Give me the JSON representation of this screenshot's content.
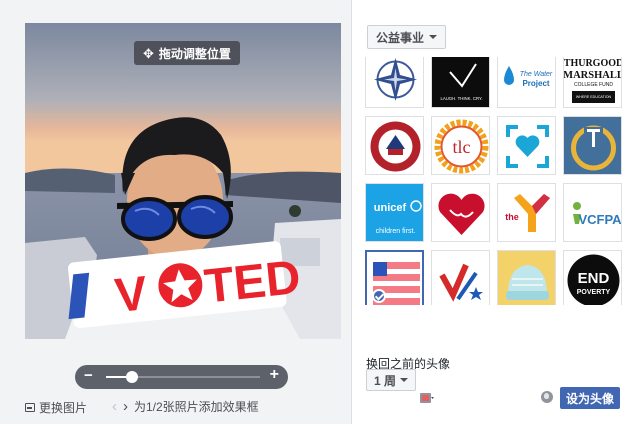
{
  "preview": {
    "drag_hint": "拖动调整位置",
    "sticker_text": "I VOTED",
    "zoom_level": 0.17
  },
  "left_footer": {
    "change_photo": "更换图片",
    "frame_nav_label": "为1/2张照片添加效果框"
  },
  "right": {
    "category": "公益事业",
    "frames": [
      {
        "name": "compass-star-frame",
        "text": ""
      },
      {
        "name": "laugh-think-cry-frame",
        "text": "LAUGH. THINK. CRY."
      },
      {
        "name": "water-project-frame",
        "text": "The Water Project"
      },
      {
        "name": "thurgood-marshall-frame",
        "text": "THURGOOD MARSHALL COLLEGE FUND"
      },
      {
        "name": "seal-frame",
        "text": ""
      },
      {
        "name": "tlc-frame",
        "text": "tlc"
      },
      {
        "name": "heart-focus-frame",
        "text": ""
      },
      {
        "name": "power-t-frame",
        "text": ""
      },
      {
        "name": "unicef-frame",
        "text": "unicef USA children first."
      },
      {
        "name": "red-heart-frame",
        "text": ""
      },
      {
        "name": "ymca-frame",
        "text": "the Y"
      },
      {
        "name": "vcfpa-frame",
        "text": "VCFPA"
      },
      {
        "name": "flag-frame",
        "text": ""
      },
      {
        "name": "check-frame",
        "text": ""
      },
      {
        "name": "knit-hat-frame",
        "text": ""
      },
      {
        "name": "end-poverty-frame",
        "text": "END POVERTY"
      }
    ],
    "selected_index": 12,
    "revert_label": "换回之前的头像",
    "duration": "1 周",
    "set_avatar_button": "设为头像"
  },
  "colors": {
    "primary_button": "#4267b2",
    "sticker_red": "#e8232c",
    "sticker_blue": "#2c54b8"
  }
}
